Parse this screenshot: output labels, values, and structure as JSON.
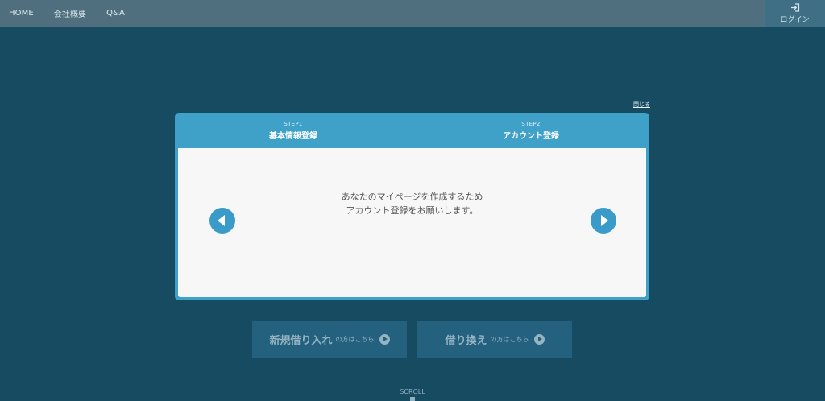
{
  "nav": {
    "items": [
      "HOME",
      "会社概要",
      "Q&A"
    ],
    "login_label": "ログイン"
  },
  "background": {
    "buttons": [
      {
        "main": "新規借り入れ",
        "sub": "の方はこちら"
      },
      {
        "main": "借り換え",
        "sub": "の方はこちら"
      }
    ],
    "scroll_label": "SCROLL"
  },
  "modal": {
    "close_label": "閉じる",
    "steps": [
      {
        "number": "STEP1",
        "title": "基本情報登録"
      },
      {
        "number": "STEP2",
        "title": "アカウント登録"
      }
    ],
    "message_line1": "あなたのマイページを作成するため",
    "message_line2": "アカウント登録をお願いします。"
  },
  "colors": {
    "background": "#174b62",
    "accent": "#3fa0c8",
    "panel": "#f7f7f7"
  }
}
